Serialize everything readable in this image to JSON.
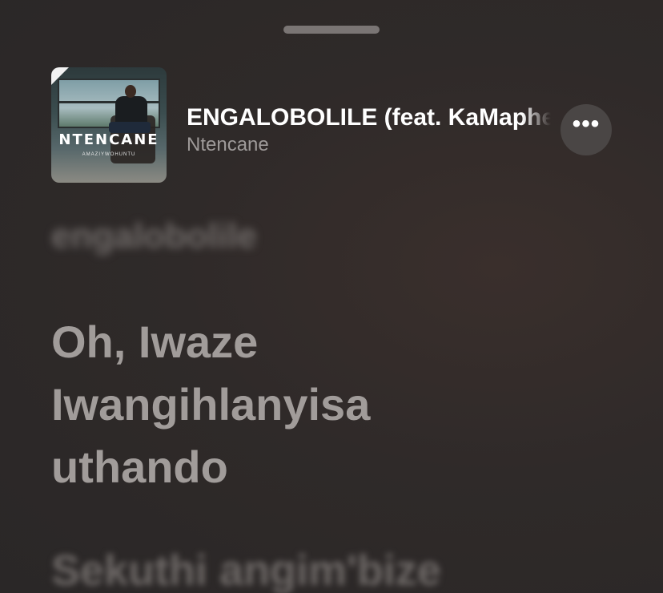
{
  "sheet": {
    "grabber": "drag-handle"
  },
  "now_playing": {
    "artwork_title": "NTENCANE",
    "artwork_subtitle": "AMAZIYWOHUNTU",
    "song_title": "ENGALOBOLILE (feat. KaMaphel",
    "artist": "Ntencane",
    "more_label": "•••"
  },
  "lyrics": {
    "previous": "engalobolile",
    "current_lines": [
      "Oh, Iwaze",
      "Iwangihlanyisa",
      "uthando"
    ],
    "next": "Sekuthi angim'bize"
  },
  "colors": {
    "background": "#2f2a29",
    "title": "#ffffff",
    "artist": "#9e9a99",
    "lyric": "#a19c9a",
    "more_button_bg": "#4a4645"
  }
}
